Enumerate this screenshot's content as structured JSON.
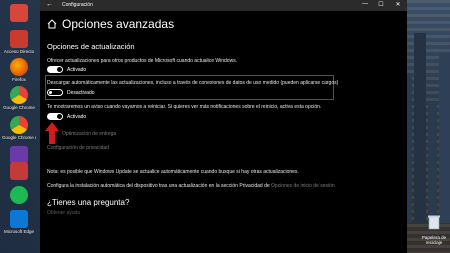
{
  "desktop": {
    "icons": [
      {
        "label": "",
        "color": "#d6463a"
      },
      {
        "label": "Acceso Directo",
        "color": "#c93a2f"
      },
      {
        "label": "Firefox",
        "color": "#e66000"
      },
      {
        "label": "Google Chrome",
        "color": "#4285f4"
      },
      {
        "label": "Google Chrome nuevo",
        "color": "#34a853"
      },
      {
        "label": "",
        "color": "#6b3aa8"
      },
      {
        "label": "",
        "color": "#c43a3a"
      },
      {
        "label": "",
        "color": "#c53529"
      },
      {
        "label": "",
        "color": "#1db954"
      },
      {
        "label": "Microsoft Edge",
        "color": "#0a78d4"
      }
    ],
    "recycle_label": "Papelera de reciclaje"
  },
  "window": {
    "title": "Configuración",
    "back_glyph": "←",
    "minimize_glyph": "—",
    "maximize_glyph": "☐",
    "close_glyph": "✕"
  },
  "header": {
    "title": "Opciones avanzadas"
  },
  "section": {
    "title": "Opciones de actualización",
    "option1_text": "Ofrecer actualizaciones para otros productos de Microsoft cuando actualice Windows.",
    "option1_state": "Activado",
    "option2_text": "Descargar automáticamente las actualizaciones, incluso a través de conexiones de datos de uso medido (pueden aplicarse cargos)",
    "option2_state": "Desactivado",
    "option3_text": "Te mostraremos un aviso cuando vayamos a reiniciar. Si quieres ver más notificaciones sobre el reinicio, activa esta opción.",
    "option3_state": "Activado",
    "link_pause": "Optimización de entrega",
    "link_privacy": "Configuración de privacidad",
    "note": "Nota: es posible que Windows Update se actualice automáticamente cuando busque si hay otras actualizaciones.",
    "config_text": "Configura la instalación automática del dispositivo tras una actualización en la sección Privacidad de",
    "config_link": "Opciones de inicio de sesión"
  },
  "help": {
    "title": "¿Tienes una pregunta?",
    "link": "Obtener ayuda"
  },
  "colors": {
    "highlight": "#d01c1c",
    "arrow": "#d01c1c"
  }
}
